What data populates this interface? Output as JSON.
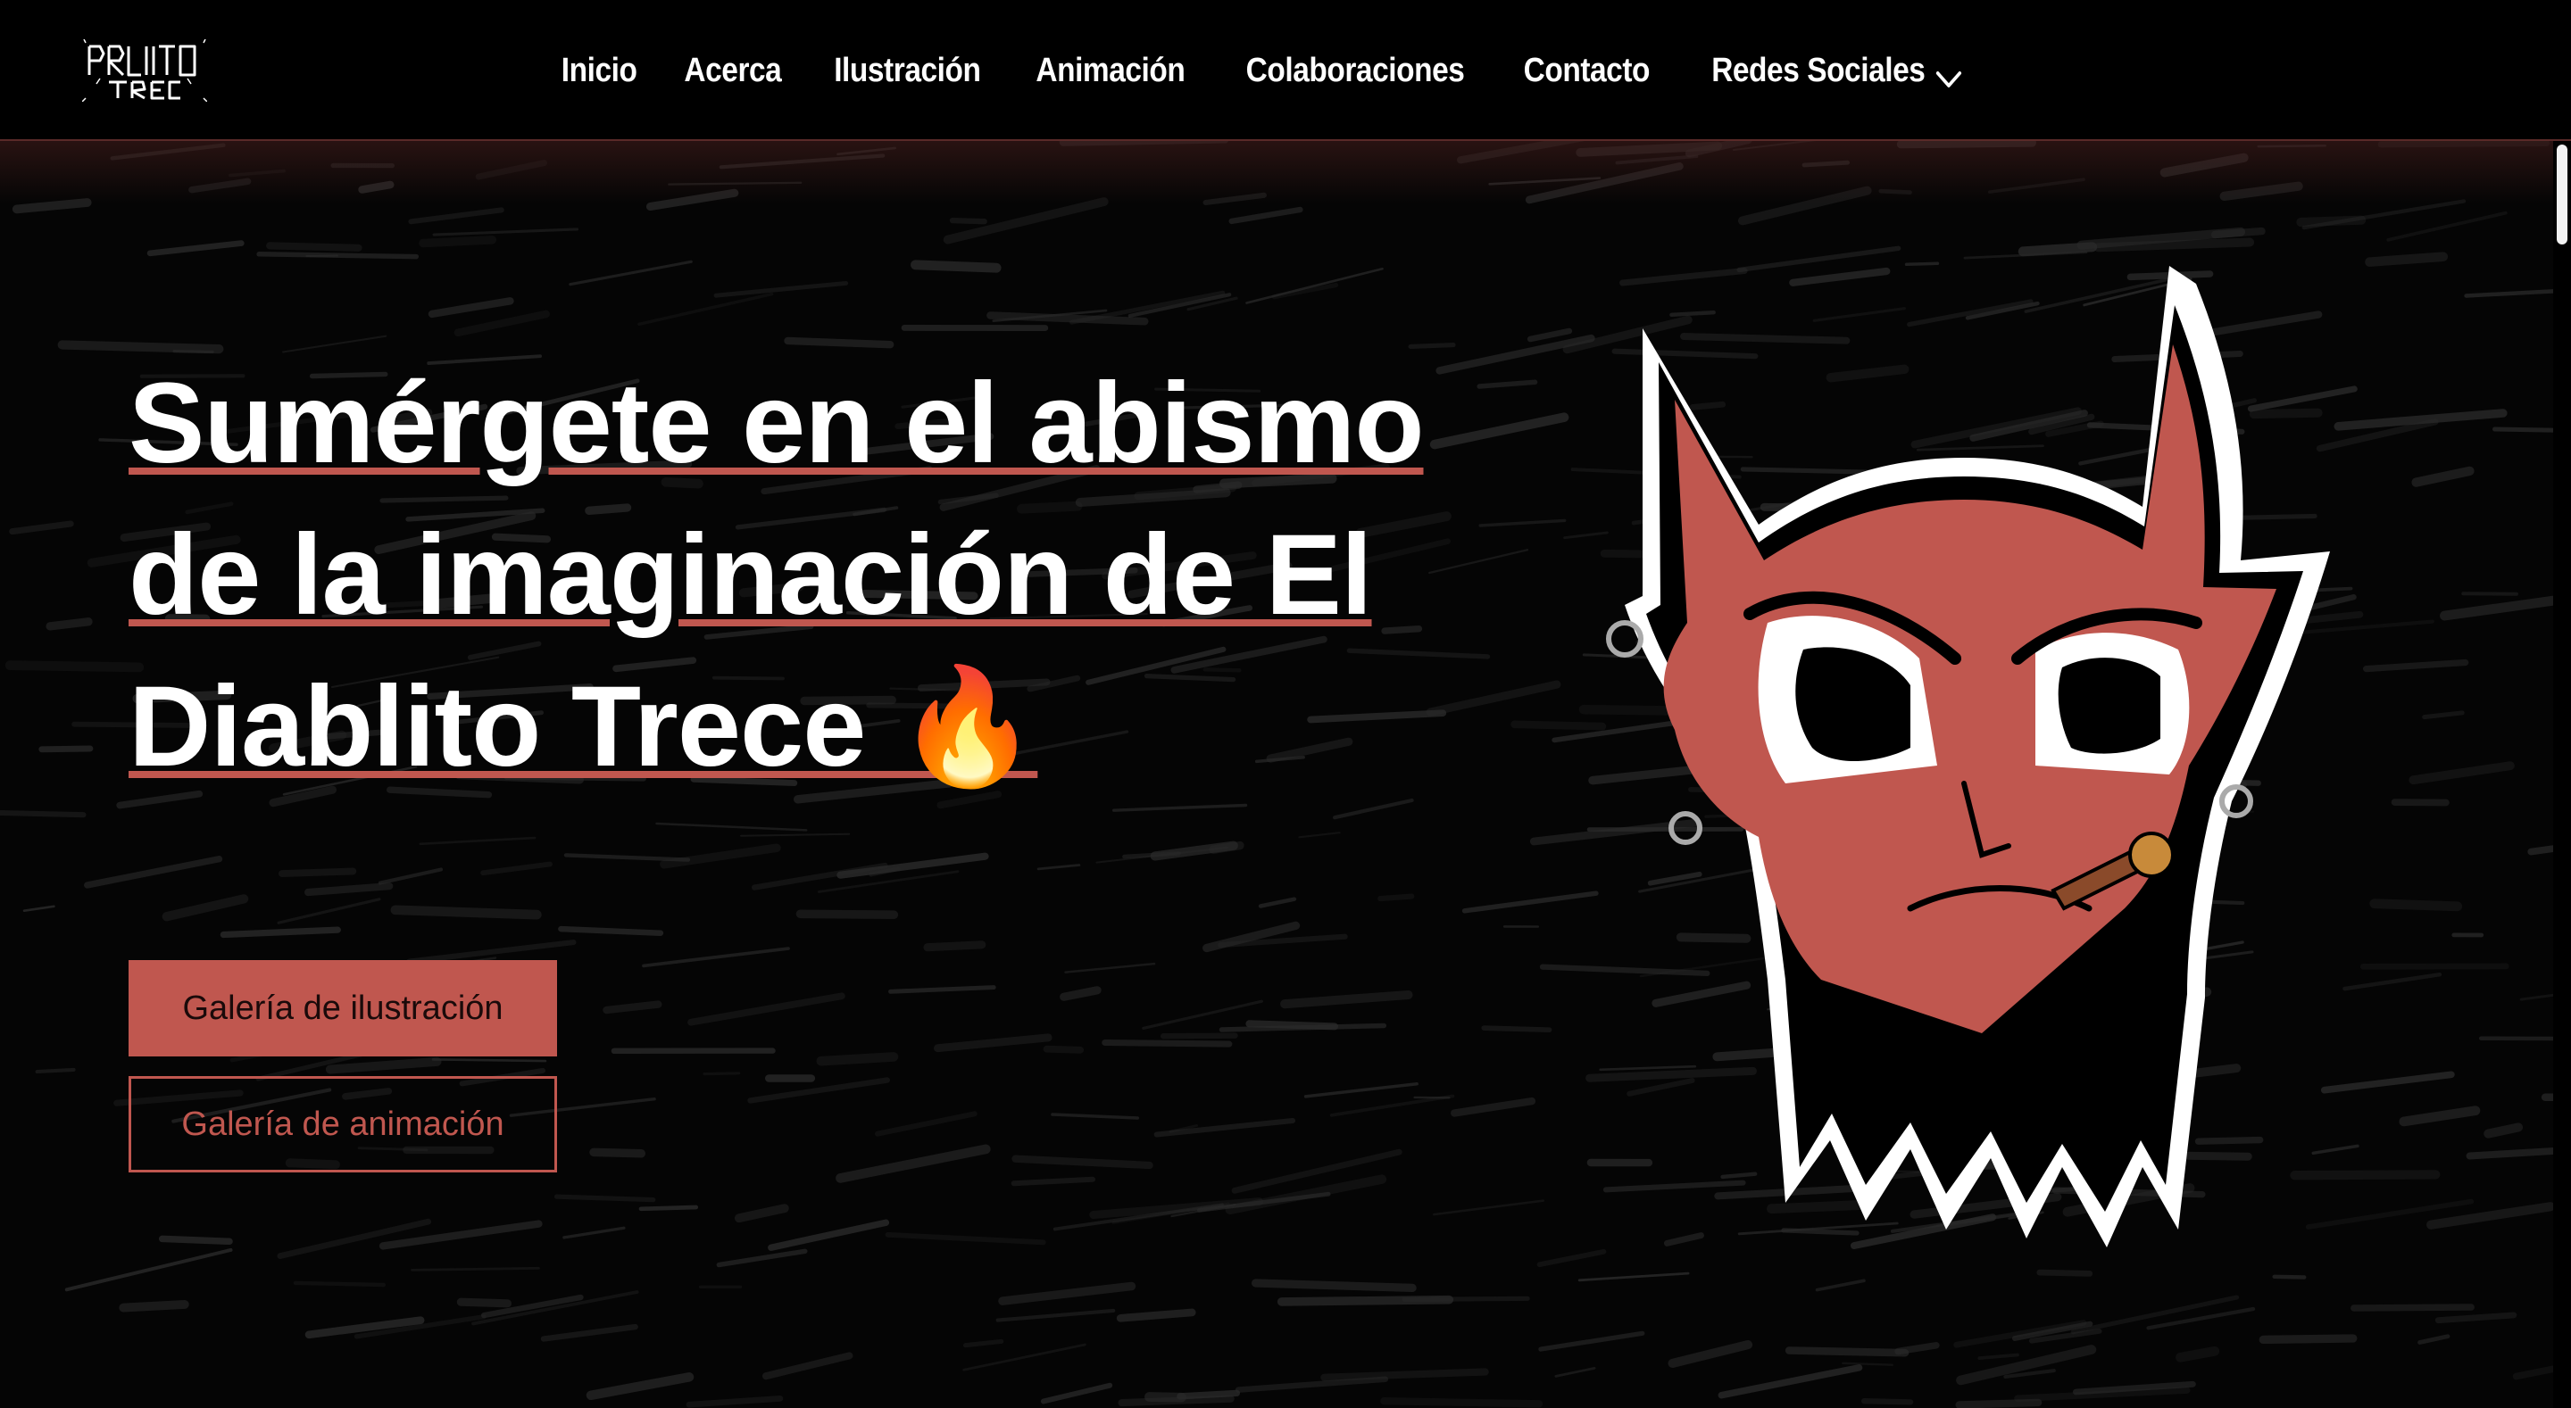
{
  "navbar": {
    "logo_alt": "El Diablito Trece",
    "links": [
      {
        "label": "Inicio"
      },
      {
        "label": "Acerca"
      },
      {
        "label": "Ilustración"
      },
      {
        "label": "Animación"
      },
      {
        "label": "Colaboraciones"
      },
      {
        "label": "Contacto"
      }
    ],
    "dropdown": {
      "label": "Redes Sociales",
      "icon": "chevron-down-icon"
    }
  },
  "hero": {
    "headline_lines": [
      "Sumérgete en el abismo",
      "de la imaginación de El",
      "Diablito Trece 🔥"
    ],
    "primary_button": "Galería de ilustración",
    "secondary_button": "Galería de animación",
    "illustration": "devil-head-illustration"
  },
  "colors": {
    "accent": "#c0574f",
    "background": "#000000",
    "text": "#ffffff"
  }
}
